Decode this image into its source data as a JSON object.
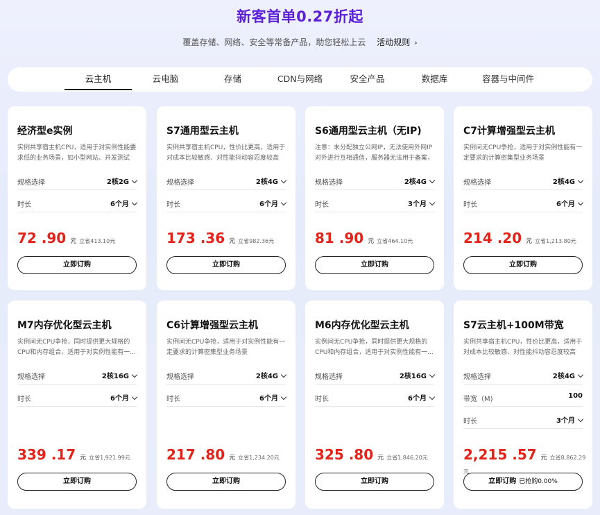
{
  "header": {
    "title": "新客首单0.27折起",
    "subtitle": "覆盖存储、网络、安全等常备产品，助您轻松上云",
    "rules_link": "活动规则",
    "rules_icon": "chevron-right-icon"
  },
  "tabs": [
    {
      "label": "云主机",
      "active": true
    },
    {
      "label": "云电脑"
    },
    {
      "label": "存储"
    },
    {
      "label": "CDN与网络"
    },
    {
      "label": "安全产品"
    },
    {
      "label": "数据库"
    },
    {
      "label": "容器与中间件"
    }
  ],
  "colors": {
    "headline": "#5b1fd6",
    "price": "#e2231a"
  },
  "cards": [
    {
      "title": "经济型e实例",
      "desc": "实例共享宿主机CPU，适用于对实例性能要求低的业务场景，如小型网站、开发测试环...",
      "spec_label": "规格选择",
      "spec_value": "2核2G",
      "duration_label": "时长",
      "duration_value": "6个月",
      "price": "72 .90",
      "unit": "元",
      "save": "立省413.10元",
      "button": "立即订购"
    },
    {
      "title": "S7通用型云主机",
      "desc": "实例共享宿主机CPU，性价比更高，适用于对成本比较敏感、对性能抖动容忍度较高的...",
      "spec_label": "规格选择",
      "spec_value": "2核4G",
      "duration_label": "时长",
      "duration_value": "6个月",
      "price": "173 .36",
      "unit": "元",
      "save": "立省982.36元",
      "button": "立即订购"
    },
    {
      "title": "S6通用型云主机（无IP)",
      "desc": "注意：未分配独立公网IP，无法使用外网IP对外进行互相通信，服务器无法用于备案，请...",
      "spec_label": "规格选择",
      "spec_value": "2核4G",
      "duration_label": "时长",
      "duration_value": "3个月",
      "price": "81 .90",
      "unit": "元",
      "save": "立省464.10元",
      "button": "立即订购"
    },
    {
      "title": "C7计算增强型云主机",
      "desc": "实例间无CPU争抢，适用于对实例性能有一定要求的计算密集型业务场景",
      "spec_label": "规格选择",
      "spec_value": "2核4G",
      "duration_label": "时长",
      "duration_value": "6个月",
      "price": "214 .20",
      "unit": "元",
      "save": "立省1,213.80元",
      "button": "立即订购"
    },
    {
      "title": "M7内存优化型云主机",
      "desc": "实例间无CPU争抢，同时提供更大规格的CPU和内存组合，适用于对实例性能有一...",
      "spec_label": "规格选择",
      "spec_value": "2核16G",
      "duration_label": "时长",
      "duration_value": "6个月",
      "price": "339 .17",
      "unit": "元",
      "save": "立省1,921.99元",
      "button": "立即订购"
    },
    {
      "title": "C6计算增强型云主机",
      "desc": "实例间无CPU争抢，适用于对实例性能有一定要求的计算密集型业务场景",
      "spec_label": "规格选择",
      "spec_value": "2核4G",
      "duration_label": "时长",
      "duration_value": "6个月",
      "price": "217 .80",
      "unit": "元",
      "save": "立省1,234.20元",
      "button": "立即订购"
    },
    {
      "title": "M6内存优化型云主机",
      "desc": "实例间无CPU争抢，同时提供更大规格的CPU和内存组合，适用于对实例性能有一...",
      "spec_label": "规格选择",
      "spec_value": "2核16G",
      "duration_label": "时长",
      "duration_value": "6个月",
      "price": "325 .80",
      "unit": "元",
      "save": "立省1,846.20元",
      "button": "立即订购"
    },
    {
      "title": "S7云主机+100M带宽",
      "desc": "实例共享宿主机CPU，性价比更高，适用于对成本比较敏感、对性能抖动容忍度较高的...",
      "spec_label": "规格选择",
      "spec_value": "2核4G",
      "bandwidth_label": "带宽（M)",
      "bandwidth_value": "100",
      "duration_label": "时长",
      "duration_value": "3个月",
      "price": "2,215 .57",
      "unit": "元",
      "save": "立省8,862.29元",
      "button": "立即订购",
      "sold": "已抢购0.00%"
    }
  ]
}
